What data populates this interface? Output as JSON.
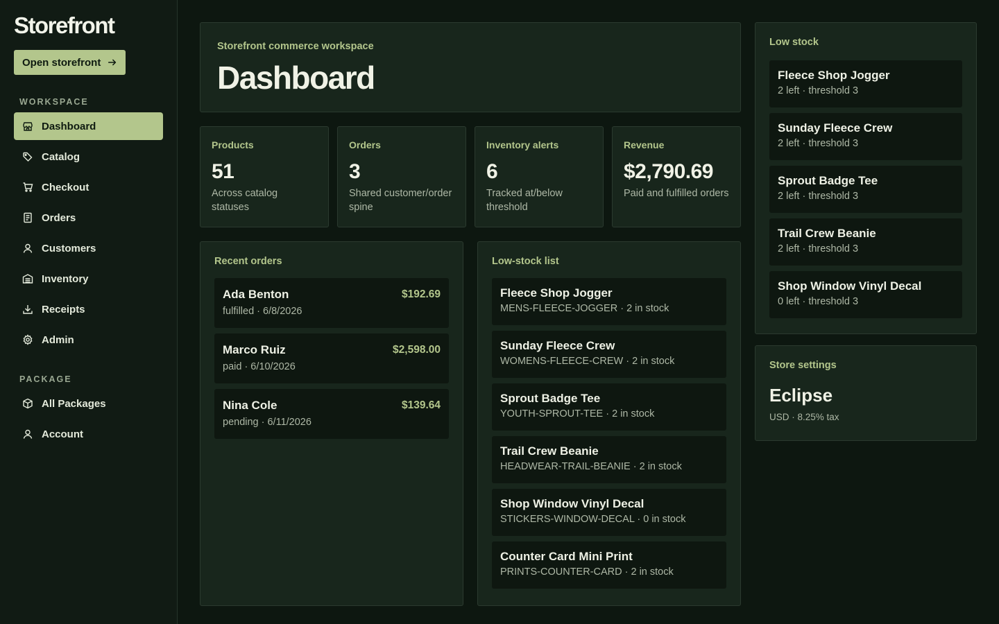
{
  "app": {
    "name": "Storefront",
    "open_label": "Open storefront"
  },
  "sidebar": {
    "workspace_label": "WORKSPACE",
    "package_label": "PACKAGE",
    "workspace_items": [
      {
        "label": "Dashboard",
        "icon": "store-icon"
      },
      {
        "label": "Catalog",
        "icon": "tag-icon"
      },
      {
        "label": "Checkout",
        "icon": "cart-icon"
      },
      {
        "label": "Orders",
        "icon": "receipt-list-icon"
      },
      {
        "label": "Customers",
        "icon": "user-icon"
      },
      {
        "label": "Inventory",
        "icon": "warehouse-icon"
      },
      {
        "label": "Receipts",
        "icon": "download-icon"
      },
      {
        "label": "Admin",
        "icon": "gear-icon"
      }
    ],
    "package_items": [
      {
        "label": "All Packages",
        "icon": "package-icon"
      },
      {
        "label": "Account",
        "icon": "user-icon"
      }
    ]
  },
  "header": {
    "eyebrow": "Storefront commerce workspace",
    "title": "Dashboard"
  },
  "stats": [
    {
      "label": "Products",
      "value": "51",
      "sub": "Across catalog statuses"
    },
    {
      "label": "Orders",
      "value": "3",
      "sub": "Shared customer/order spine"
    },
    {
      "label": "Inventory alerts",
      "value": "6",
      "sub": "Tracked at/below threshold"
    },
    {
      "label": "Revenue",
      "value": "$2,790.69",
      "sub": "Paid and fulfilled orders"
    }
  ],
  "recent_orders": {
    "title": "Recent orders",
    "items": [
      {
        "name": "Ada Benton",
        "amount": "$192.69",
        "meta": "fulfilled · 6/8/2026"
      },
      {
        "name": "Marco Ruiz",
        "amount": "$2,598.00",
        "meta": "paid · 6/10/2026"
      },
      {
        "name": "Nina Cole",
        "amount": "$139.64",
        "meta": "pending · 6/11/2026"
      }
    ]
  },
  "low_stock_list": {
    "title": "Low-stock list",
    "items": [
      {
        "name": "Fleece Shop Jogger",
        "meta": "MENS-FLEECE-JOGGER · 2 in stock"
      },
      {
        "name": "Sunday Fleece Crew",
        "meta": "WOMENS-FLEECE-CREW · 2 in stock"
      },
      {
        "name": "Sprout Badge Tee",
        "meta": "YOUTH-SPROUT-TEE · 2 in stock"
      },
      {
        "name": "Trail Crew Beanie",
        "meta": "HEADWEAR-TRAIL-BEANIE · 2 in stock"
      },
      {
        "name": "Shop Window Vinyl Decal",
        "meta": "STICKERS-WINDOW-DECAL · 0 in stock"
      },
      {
        "name": "Counter Card Mini Print",
        "meta": "PRINTS-COUNTER-CARD · 2 in stock"
      }
    ]
  },
  "low_stock": {
    "title": "Low stock",
    "items": [
      {
        "name": "Fleece Shop Jogger",
        "meta": "2 left · threshold 3"
      },
      {
        "name": "Sunday Fleece Crew",
        "meta": "2 left · threshold 3"
      },
      {
        "name": "Sprout Badge Tee",
        "meta": "2 left · threshold 3"
      },
      {
        "name": "Trail Crew Beanie",
        "meta": "2 left · threshold 3"
      },
      {
        "name": "Shop Window Vinyl Decal",
        "meta": "0 left · threshold 3"
      }
    ]
  },
  "store_settings": {
    "title": "Store settings",
    "name": "Eclipse",
    "meta": "USD · 8.25% tax"
  },
  "colors": {
    "accent": "#b3c68c",
    "background": "#0d1710",
    "panel": "#18261c",
    "card": "#0e1710"
  }
}
